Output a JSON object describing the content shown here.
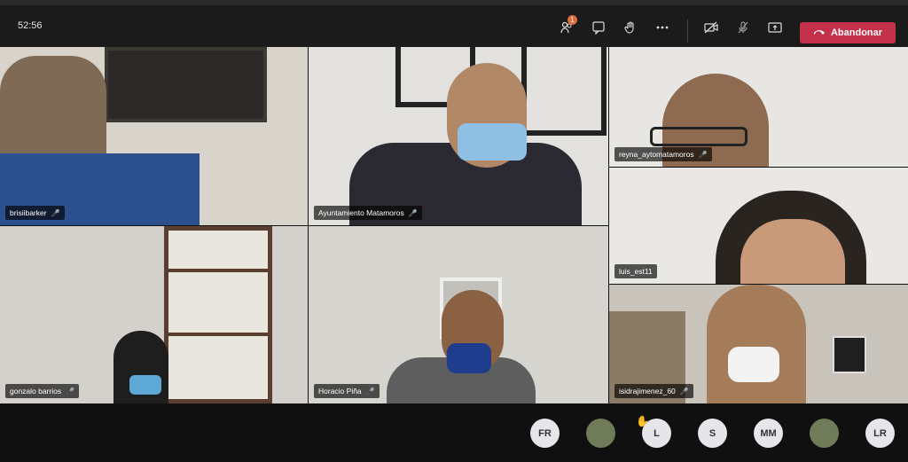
{
  "header": {
    "timer": "52:56",
    "badge_count": "1",
    "leave_label": "Abandonar"
  },
  "icons": {
    "participants": "people-icon",
    "chat": "chat-icon",
    "raise_hand": "hand-icon",
    "more": "more-icon",
    "camera": "camera-off-icon",
    "mic": "mic-off-icon",
    "share": "share-icon",
    "phone": "phone-hangup-icon"
  },
  "participants": [
    {
      "name": "brisiibarker"
    },
    {
      "name": "Ayuntamiento Matamoros"
    },
    {
      "name": "reyna_aytomatamoros"
    },
    {
      "name": "luis_est11"
    },
    {
      "name": "gonzalo barrios"
    },
    {
      "name": "Horacio Piña"
    },
    {
      "name": "isidrajimenez_60"
    }
  ],
  "bottom_avatars": [
    {
      "initials": "FR"
    },
    {
      "initials": ""
    },
    {
      "initials": "L"
    },
    {
      "initials": "S"
    },
    {
      "initials": "MM"
    },
    {
      "initials": ""
    },
    {
      "initials": "LR"
    }
  ],
  "colors": {
    "leave": "#c4314b",
    "bar": "#1b1b1b"
  }
}
